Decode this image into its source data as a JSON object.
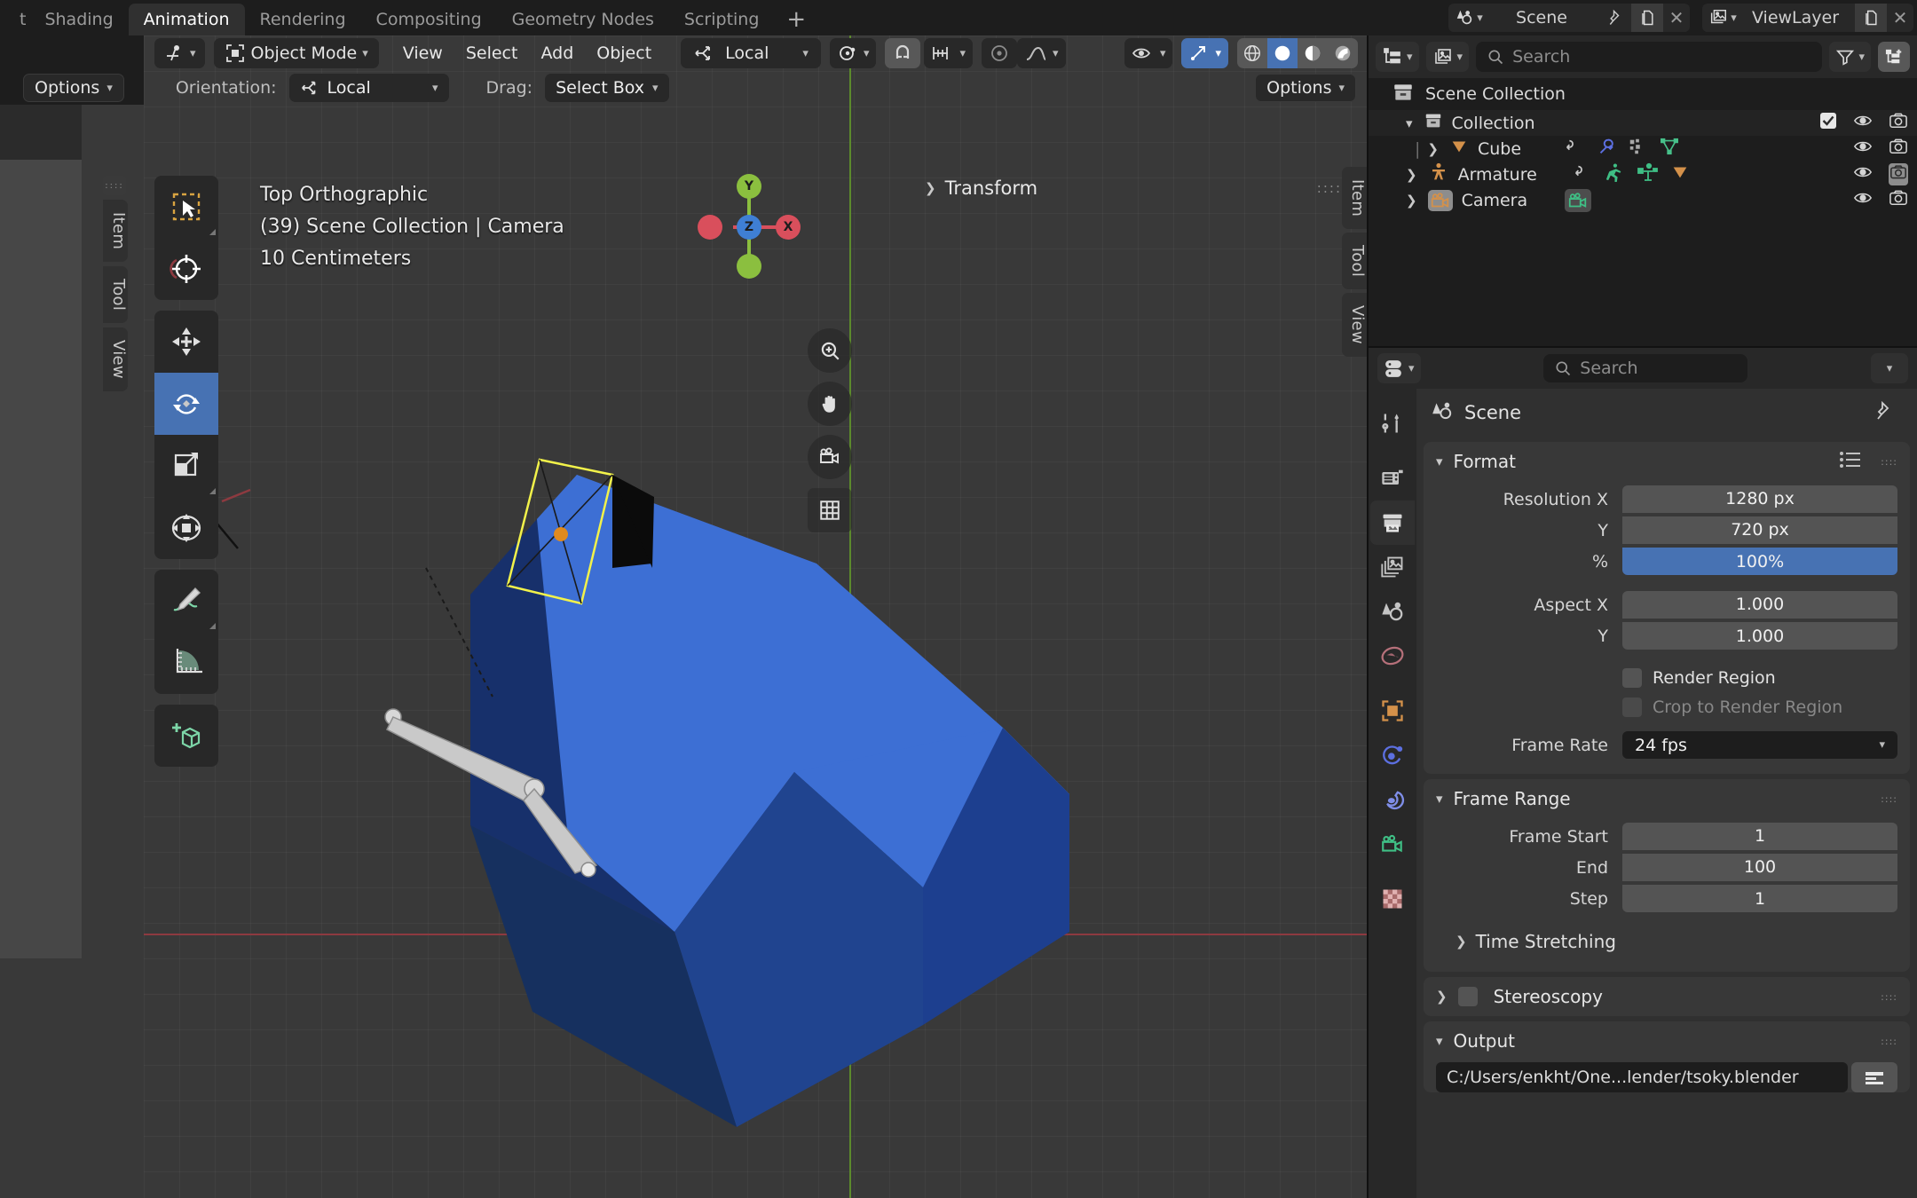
{
  "topbar": {
    "workspaces": [
      {
        "label": "t",
        "active": false,
        "partial": true
      },
      {
        "label": "Shading",
        "active": false
      },
      {
        "label": "Animation",
        "active": true
      },
      {
        "label": "Rendering",
        "active": false
      },
      {
        "label": "Compositing",
        "active": false
      },
      {
        "label": "Geometry Nodes",
        "active": false
      },
      {
        "label": "Scripting",
        "active": false
      },
      {
        "label": "+",
        "active": false
      }
    ],
    "scene_name": "Scene",
    "viewlayer_name": "ViewLayer",
    "close_glyph": "✕"
  },
  "viewport": {
    "header": {
      "mode": "Object Mode",
      "menus": [
        "View",
        "Select",
        "Add",
        "Object"
      ],
      "orientation": "Local",
      "options_label": "Options"
    },
    "toolsettings": {
      "orientation_label": "Orientation:",
      "orientation_value": "Local",
      "drag_label": "Drag:",
      "drag_value": "Select Box",
      "options_label": "Options"
    },
    "overlay": {
      "view_name": "Top Orthographic",
      "collection_line": "(39) Scene Collection | Camera",
      "grid_scale": "10 Centimeters"
    },
    "gizmo": {
      "x": "X",
      "y": "Y",
      "z": "Z"
    },
    "side_tabs": [
      "Item",
      "Tool",
      "View"
    ],
    "side_tabs_left": [
      "Item",
      "Tool",
      "View"
    ],
    "npanel_title": "Transform",
    "toolbar_tools": [
      "tweak-select-tool",
      "cursor-tool",
      "move-tool",
      "rotate-tool",
      "scale-tool",
      "transform-tool",
      "annotate-tool",
      "measure-tool",
      "add-cube-tool"
    ],
    "active_tool": "rotate-tool"
  },
  "outliner": {
    "search_placeholder": "Search",
    "rows": [
      {
        "name": "Scene Collection",
        "indent": 0,
        "icon": "collection-icon",
        "expander": "",
        "badges": [],
        "checkbox": false,
        "eye": false,
        "camera": false
      },
      {
        "name": "Collection",
        "indent": 1,
        "icon": "collection-icon",
        "expander": "⌄",
        "badges": [],
        "checkbox": true,
        "eye": true,
        "camera": true
      },
      {
        "name": "Cube",
        "indent": 2,
        "icon": "mesh-data-icon",
        "expander": "›",
        "badges": [
          "animation-icon",
          "modifier-icon",
          "material-icon",
          "mesh-icon"
        ],
        "checkbox": false,
        "eye": true,
        "camera": true
      },
      {
        "name": "Armature",
        "indent": 1,
        "icon": "armature-icon",
        "expander": "›",
        "badges": [
          "animation-icon",
          "pose-icon",
          "armature-data-icon",
          "mesh-data-icon"
        ],
        "checkbox": false,
        "eye": true,
        "camera": true
      },
      {
        "name": "Camera",
        "indent": 1,
        "icon": "camera-obj-icon",
        "expander": "›",
        "badges": [
          "camera-data-icon"
        ],
        "checkbox": false,
        "eye": true,
        "camera": true
      }
    ]
  },
  "properties": {
    "search_placeholder": "Search",
    "breadcrumb": "Scene",
    "tabs": [
      "tool-icon",
      "render-icon",
      "output-icon",
      "viewlayer-icon",
      "scene-icon",
      "world-icon",
      "object-icon",
      "physics-icon",
      "constraints-icon",
      "camera-data-icon",
      "texture-icon"
    ],
    "active_tab": "output-icon",
    "format": {
      "title": "Format",
      "resolution_x_label": "Resolution X",
      "resolution_x_value": "1280 px",
      "resolution_y_label": "Y",
      "resolution_y_value": "720 px",
      "percent_label": "%",
      "percent_value": "100%",
      "aspect_x_label": "Aspect X",
      "aspect_x_value": "1.000",
      "aspect_y_label": "Y",
      "aspect_y_value": "1.000",
      "render_region_label": "Render Region",
      "crop_label": "Crop to Render Region",
      "frame_rate_label": "Frame Rate",
      "frame_rate_value": "24 fps"
    },
    "frame_range": {
      "title": "Frame Range",
      "start_label": "Frame Start",
      "start_value": "1",
      "end_label": "End",
      "end_value": "100",
      "step_label": "Step",
      "step_value": "1",
      "time_stretching_label": "Time Stretching"
    },
    "stereoscopy": {
      "title": "Stereoscopy"
    },
    "output": {
      "title": "Output",
      "path_value": "C:/Users/enkht/One...lender/tsoky.blender"
    }
  },
  "colors": {
    "accent_blue": "#4772b3",
    "cube_light": "#3d6fd4",
    "cube_dark": "#17306b",
    "camera_yellow": "#f2f24a",
    "axis_green": "#5c8a2c",
    "axis_red": "#8d3a40",
    "panel_bg": "#303030",
    "header_bg": "#282828",
    "window_bg": "#1d1d1d"
  }
}
